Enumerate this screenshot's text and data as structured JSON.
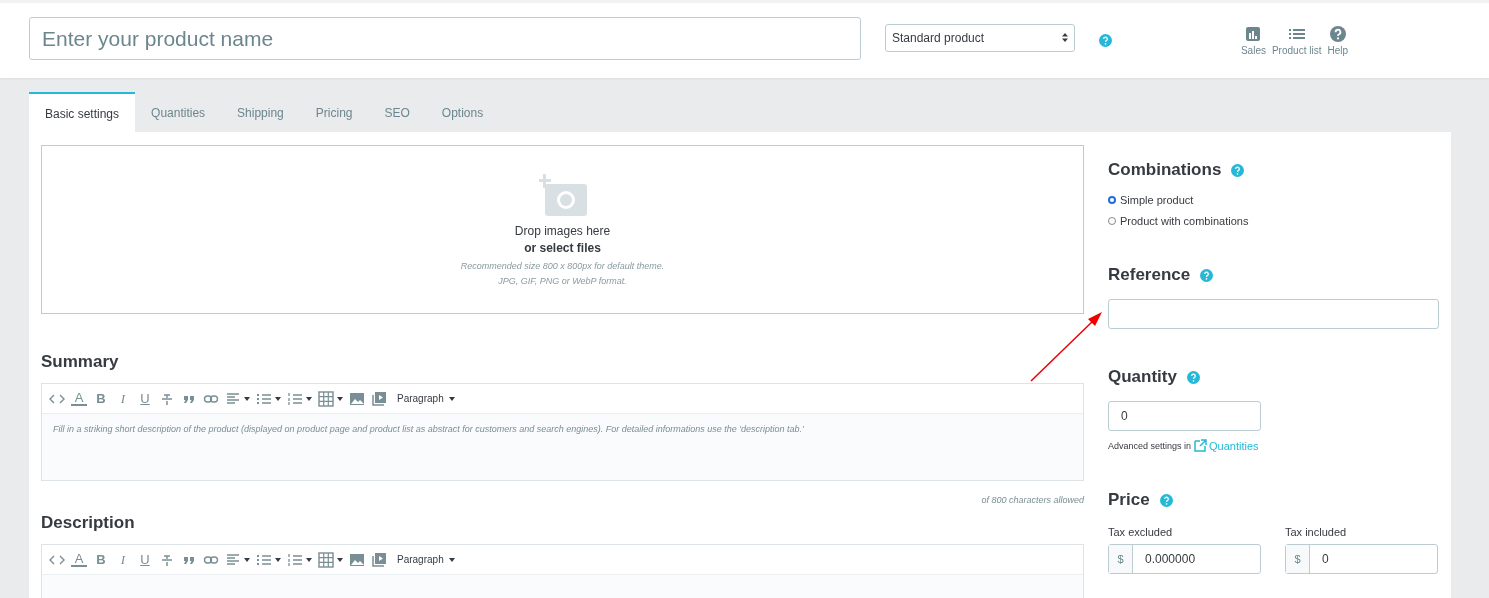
{
  "header": {
    "product_name": {
      "placeholder": "Enter your product name"
    },
    "product_type": {
      "value": "Standard product"
    },
    "actions": [
      {
        "kind": "sales",
        "label": "Sales"
      },
      {
        "kind": "list",
        "label": "Product list"
      },
      {
        "kind": "help",
        "label": "Help"
      }
    ]
  },
  "tabs": [
    {
      "label": "Basic settings",
      "selected": true
    },
    {
      "label": "Quantities",
      "selected": false
    },
    {
      "label": "Shipping",
      "selected": false
    },
    {
      "label": "Pricing",
      "selected": false
    },
    {
      "label": "SEO",
      "selected": false
    },
    {
      "label": "Options",
      "selected": false
    }
  ],
  "dropzone": {
    "title": "Drop images here",
    "link": "or select files",
    "hints": [
      "Recommended size 800 x 800px for default theme.",
      "JPG, GIF, PNG or WebP format."
    ]
  },
  "editors": [
    {
      "heading": "Summary",
      "toolbar": [
        {
          "kind": "code"
        },
        {
          "kind": "color",
          "glyph": "A"
        },
        {
          "kind": "bold",
          "glyph": "B"
        },
        {
          "kind": "italic",
          "glyph": "I"
        },
        {
          "kind": "underline",
          "glyph": "U"
        },
        {
          "kind": "strike"
        },
        {
          "kind": "quote"
        },
        {
          "kind": "link"
        },
        {
          "kind": "align"
        },
        {
          "kind": "bullets"
        },
        {
          "kind": "numbers"
        },
        {
          "kind": "table"
        },
        {
          "kind": "image"
        },
        {
          "kind": "media"
        },
        {
          "kind": "format",
          "label": "Paragraph"
        }
      ],
      "placeholder": "Fill in a striking short description of the product (displayed on product page and product list as abstract for customers and search engines). For detailed informations use the 'description tab.'",
      "counter": "of 800 characters allowed"
    },
    {
      "heading": "Description",
      "toolbar": [
        {
          "kind": "code"
        },
        {
          "kind": "color",
          "glyph": "A"
        },
        {
          "kind": "bold",
          "glyph": "B"
        },
        {
          "kind": "italic",
          "glyph": "I"
        },
        {
          "kind": "underline",
          "glyph": "U"
        },
        {
          "kind": "strike"
        },
        {
          "kind": "quote"
        },
        {
          "kind": "link"
        },
        {
          "kind": "align"
        },
        {
          "kind": "bullets"
        },
        {
          "kind": "numbers"
        },
        {
          "kind": "table"
        },
        {
          "kind": "image"
        },
        {
          "kind": "media"
        },
        {
          "kind": "format",
          "label": "Paragraph"
        }
      ]
    }
  ],
  "combinations": {
    "heading": "Combinations",
    "options": [
      {
        "label": "Simple product",
        "selected": true
      },
      {
        "label": "Product with combinations",
        "selected": false
      }
    ]
  },
  "reference": {
    "heading": "Reference"
  },
  "quantity": {
    "heading": "Quantity",
    "value": "0",
    "advanced_text": "Advanced settings in",
    "advanced_link": "Quantities"
  },
  "price": {
    "heading": "Price",
    "fields": [
      {
        "label": "Tax excluded",
        "currency": "$",
        "value": "0.000000"
      },
      {
        "label": "Tax included",
        "currency": "$",
        "value": "0"
      }
    ]
  }
}
